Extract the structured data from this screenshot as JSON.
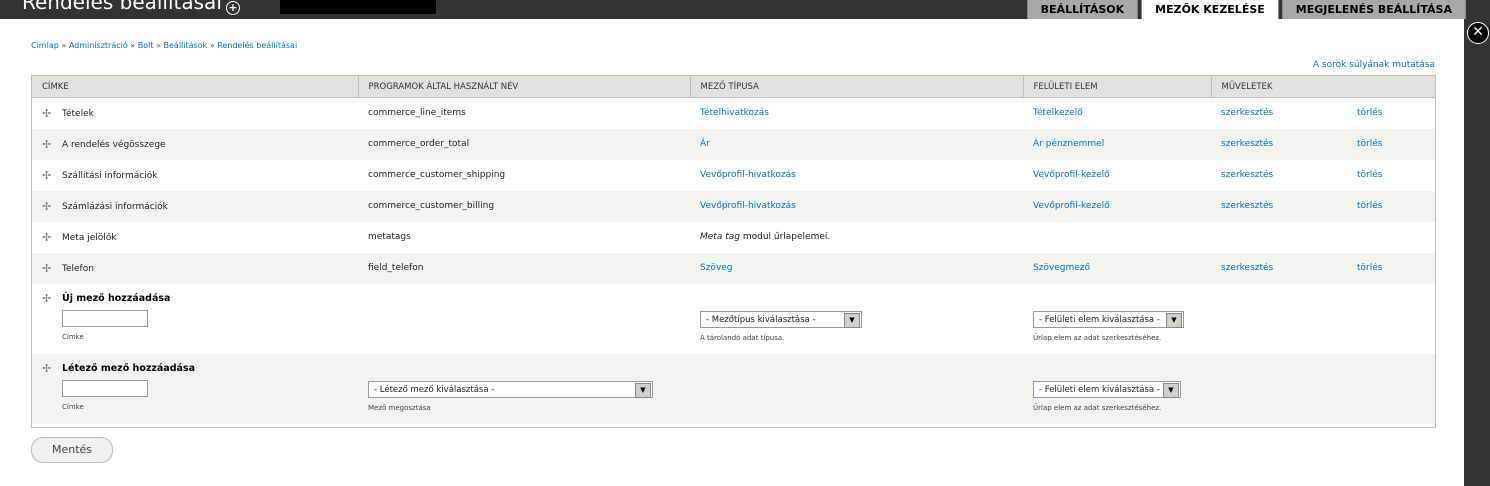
{
  "page": {
    "title": "Rendelés beállításai"
  },
  "tabs": [
    "BEÁLLÍTÁSOK",
    "MEZŐK KEZELÉSE",
    "MEGJELENÉS BEÁLLÍTÁSA"
  ],
  "breadcrumb": [
    "Címlap",
    "Adminisztráció",
    "Bolt",
    "Beállítások",
    "Rendelés beállításai"
  ],
  "breadcrumb_sep": "»",
  "weights_link": "A sorok súlyának mutatása",
  "table": {
    "headers": [
      "CÍMKE",
      "PROGRAMOK ÁLTAL HASZNÁLT NÉV",
      "MEZŐ TÍPUSA",
      "FELÜLETI ELEM",
      "MŰVELETEK"
    ],
    "rows": [
      {
        "label": "Tételek",
        "machine": "commerce_line_items",
        "type": "Tételhivatkozás",
        "widget": "Tételkezelő",
        "edit": "szerkesztés",
        "delete": "törlés"
      },
      {
        "label": "A rendelés végösszege",
        "machine": "commerce_order_total",
        "type": "Ár",
        "widget": "Ár pénznemmel",
        "edit": "szerkesztés",
        "delete": "törlés"
      },
      {
        "label": "Szállítási információk",
        "machine": "commerce_customer_shipping",
        "type": "Vevőprofil-hivatkozás",
        "widget": "Vevőprofil-kezelő",
        "edit": "szerkesztés",
        "delete": "törlés"
      },
      {
        "label": "Számlázási információk",
        "machine": "commerce_customer_billing",
        "type": "Vevőprofil-hivatkozás",
        "widget": "Vevőprofil-kezelő",
        "edit": "szerkesztés",
        "delete": "törlés"
      },
      {
        "label": "Telefon",
        "machine": "field_telefon",
        "type": "Szöveg",
        "widget": "Szövegmező",
        "edit": "szerkesztés",
        "delete": "törlés"
      }
    ],
    "meta": {
      "label": "Meta jelölők",
      "machine": "metatags",
      "desc_em": "Meta tag",
      "desc_rest": " modul űrlapelemei."
    }
  },
  "new_field": {
    "title": "Új mező hozzáadása",
    "label_desc": "Címke",
    "type_select": "- Mezőtípus kiválasztása -",
    "type_desc": "A tárolandó adat típusa.",
    "widget_select": "- Felületi elem kiválasztása -",
    "widget_desc": "Űrlap elem az adat szerkesztéséhez."
  },
  "existing_field": {
    "title": "Létező mező hozzáadása",
    "label_desc": "Címke",
    "field_select": "- Létező mező kiválasztása -",
    "field_desc": "Mező megosztása",
    "widget_select": "- Felületi elem kiválasztása -",
    "widget_desc": "Űrlap elem az adat szerkesztéséhez."
  },
  "save_label": "Mentés",
  "icons": {
    "drag": "move-arrows-icon",
    "close": "close-icon",
    "add": "plus-circle-icon"
  }
}
